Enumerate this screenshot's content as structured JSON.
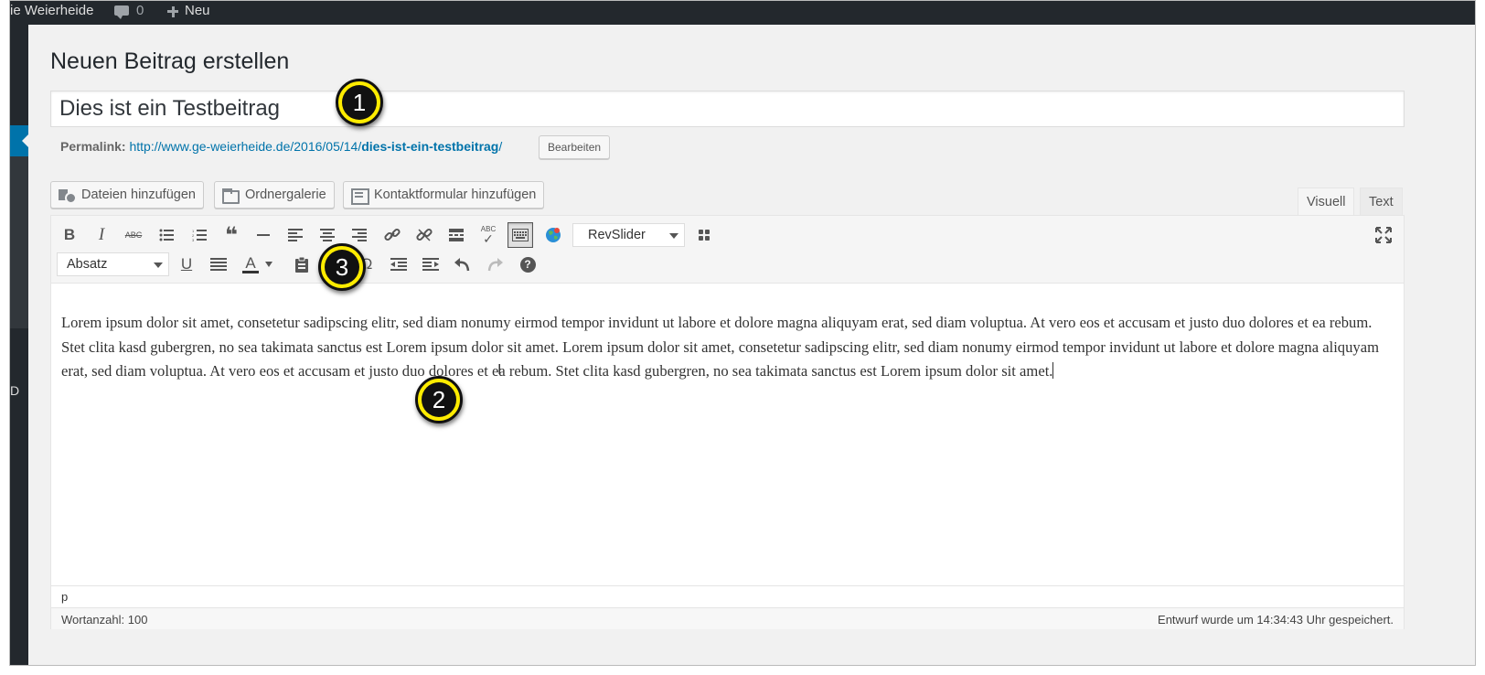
{
  "adminbar": {
    "site_name": "ie Weierheide",
    "comment_count": "0",
    "new_label": "Neu"
  },
  "adminmenu": {
    "partial_letter": "D"
  },
  "page": {
    "title": "Neuen Beitrag erstellen"
  },
  "post": {
    "title_value": "Dies ist ein Testbeitrag",
    "permalink_label": "Permalink:",
    "permalink_base": "http://www.ge-weierheide.de/2016/05/14/",
    "permalink_slug": "dies-ist-ein-testbeitrag",
    "permalink_trailing": "/",
    "edit_button": "Bearbeiten"
  },
  "media_buttons": {
    "add_files": "Dateien hinzufügen",
    "folder_gallery": "Ordnergalerie",
    "add_contact_form": "Kontaktformular hinzufügen"
  },
  "editor_tabs": {
    "visual": "Visuell",
    "text": "Text"
  },
  "toolbar": {
    "bold": "B",
    "italic": "I",
    "strike": "ABC",
    "spellcheck": "ABC",
    "revslider": "RevSlider",
    "format_select": "Absatz",
    "underline": "U",
    "text_color": "A",
    "special_char": "Ω",
    "help": "?"
  },
  "content": {
    "text": "Lorem ipsum dolor sit amet, consetetur sadipscing elitr, sed diam nonumy eirmod tempor invidunt ut labore et dolore magna aliquyam erat, sed diam voluptua. At vero eos et accusam et justo duo dolores et ea rebum. Stet clita kasd gubergren, no sea takimata sanctus est Lorem ipsum dolor sit amet. Lorem ipsum dolor sit amet, consetetur sadipscing elitr, sed diam nonumy eirmod tempor invidunt ut labore et dolore magna aliquyam erat, sed diam voluptua. At vero eos et accusam et justo duo dolores et ea rebum. Stet clita kasd gubergren, no sea takimata sanctus est Lorem ipsum dolor sit amet."
  },
  "pathbar": {
    "element": "p"
  },
  "status": {
    "word_count": "Wortanzahl: 100",
    "draft_saved": "Entwurf wurde um 14:34:43 Uhr gespeichert."
  },
  "markers": {
    "one": "1",
    "two": "2",
    "three": "3"
  },
  "colors": {
    "admin_dark": "#23282d",
    "accent_blue": "#0073aa",
    "marker_yellow": "#ffec00"
  }
}
